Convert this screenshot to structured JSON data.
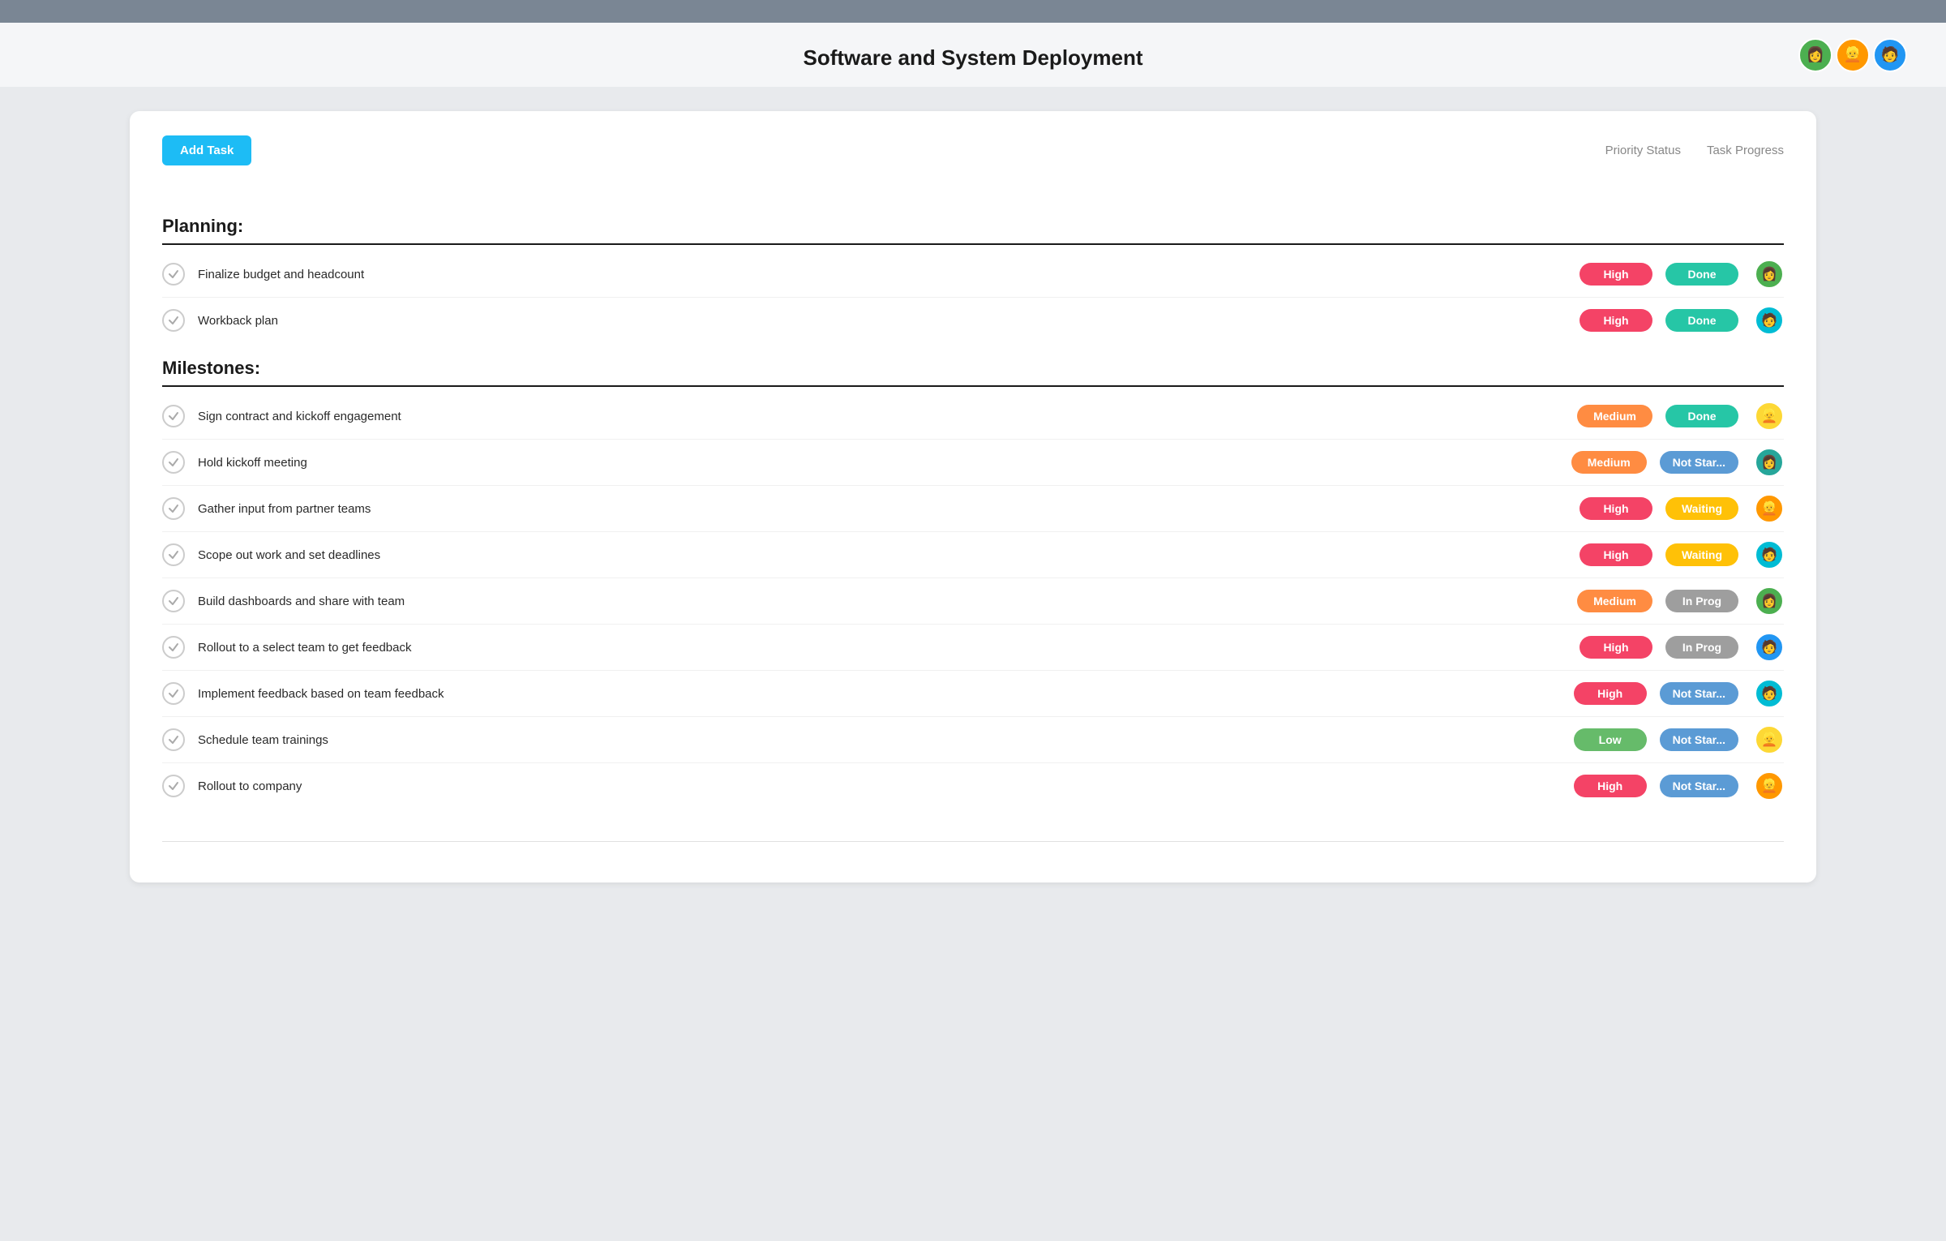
{
  "topbar": {},
  "header": {
    "title": "Software and System Deployment",
    "avatars": [
      {
        "id": "avatar-1",
        "color": "ta-green",
        "emoji": "👩"
      },
      {
        "id": "avatar-2",
        "color": "ta-orange",
        "emoji": "👱"
      },
      {
        "id": "avatar-3",
        "color": "ta-blue",
        "emoji": "🧑"
      }
    ]
  },
  "card": {
    "add_task_label": "Add Task",
    "col_priority": "Priority Status",
    "col_progress": "Task Progress",
    "sections": [
      {
        "id": "planning",
        "title": "Planning:",
        "tasks": [
          {
            "id": "t1",
            "name": "Finalize budget and headcount",
            "priority": "High",
            "priority_class": "priority-high",
            "status": "Done",
            "status_class": "status-done",
            "avatar_color": "ta-green",
            "avatar_emoji": "👩"
          },
          {
            "id": "t2",
            "name": "Workback plan",
            "priority": "High",
            "priority_class": "priority-high",
            "status": "Done",
            "status_class": "status-done",
            "avatar_color": "ta-cyan",
            "avatar_emoji": "🧑"
          }
        ]
      },
      {
        "id": "milestones",
        "title": "Milestones:",
        "tasks": [
          {
            "id": "t3",
            "name": "Sign contract and kickoff engagement",
            "priority": "Medium",
            "priority_class": "priority-medium",
            "status": "Done",
            "status_class": "status-done",
            "avatar_color": "ta-yellow",
            "avatar_emoji": "👱"
          },
          {
            "id": "t4",
            "name": "Hold kickoff meeting",
            "priority": "Medium",
            "priority_class": "priority-medium",
            "status": "Not Star...",
            "status_class": "status-not-started",
            "avatar_color": "ta-teal",
            "avatar_emoji": "👩"
          },
          {
            "id": "t5",
            "name": "Gather input from partner teams",
            "priority": "High",
            "priority_class": "priority-high",
            "status": "Waiting",
            "status_class": "status-waiting",
            "avatar_color": "ta-orange",
            "avatar_emoji": "👱"
          },
          {
            "id": "t6",
            "name": "Scope out work and set deadlines",
            "priority": "High",
            "priority_class": "priority-high",
            "status": "Waiting",
            "status_class": "status-waiting",
            "avatar_color": "ta-cyan",
            "avatar_emoji": "🧑"
          },
          {
            "id": "t7",
            "name": "Build dashboards and share with team",
            "priority": "Medium",
            "priority_class": "priority-medium",
            "status": "In Prog",
            "status_class": "status-in-progress",
            "avatar_color": "ta-green",
            "avatar_emoji": "👩"
          },
          {
            "id": "t8",
            "name": "Rollout to a select team to get feedback",
            "priority": "High",
            "priority_class": "priority-high",
            "status": "In Prog",
            "status_class": "status-in-progress",
            "avatar_color": "ta-blue",
            "avatar_emoji": "🧑"
          },
          {
            "id": "t9",
            "name": "Implement feedback based on team feedback",
            "priority": "High",
            "priority_class": "priority-high",
            "status": "Not Star...",
            "status_class": "status-not-started",
            "avatar_color": "ta-cyan",
            "avatar_emoji": "🧑"
          },
          {
            "id": "t10",
            "name": "Schedule team trainings",
            "priority": "Low",
            "priority_class": "priority-low",
            "status": "Not Star...",
            "status_class": "status-not-started",
            "avatar_color": "ta-yellow",
            "avatar_emoji": "👱"
          },
          {
            "id": "t11",
            "name": "Rollout to company",
            "priority": "High",
            "priority_class": "priority-high",
            "status": "Not Star...",
            "status_class": "status-not-started",
            "avatar_color": "ta-orange",
            "avatar_emoji": "👱"
          }
        ]
      }
    ]
  }
}
